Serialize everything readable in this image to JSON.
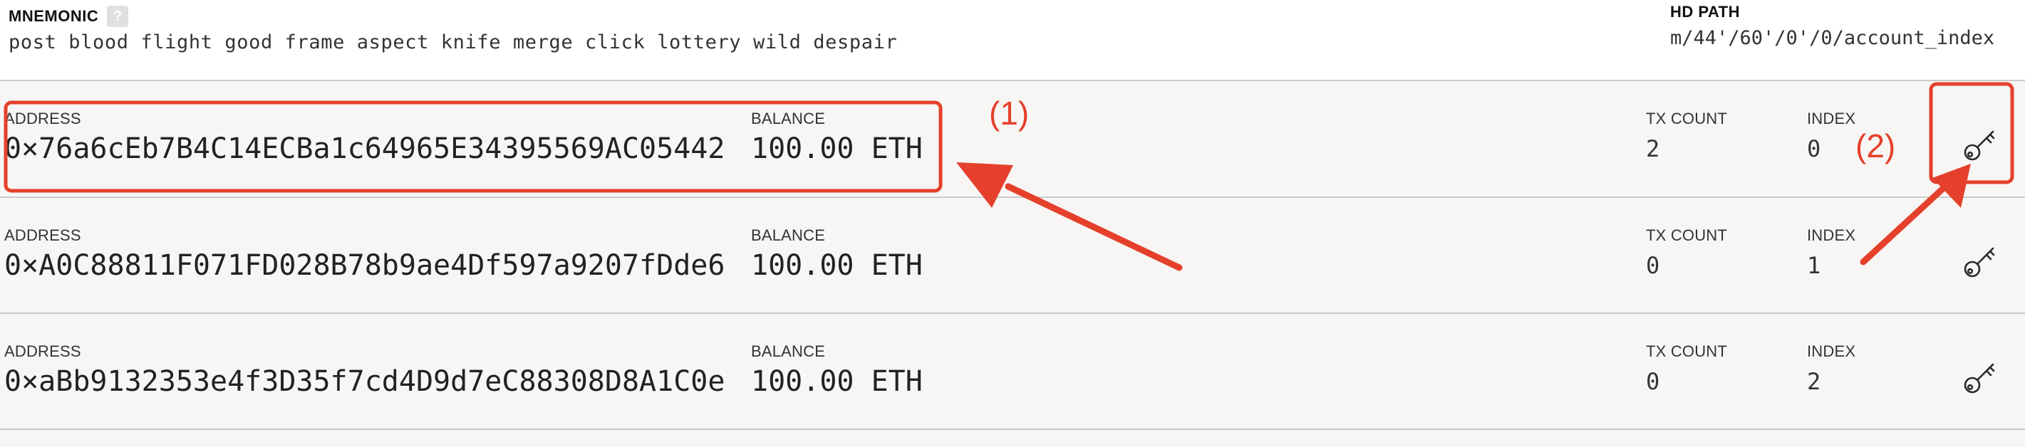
{
  "header": {
    "mnemonic_label": "MNEMONIC",
    "help_glyph": "?",
    "mnemonic_words": "post blood flight good frame aspect knife merge click lottery wild despair",
    "hd_path_label": "HD PATH",
    "hd_path_value": "m/44'/60'/0'/0/account_index"
  },
  "accounts": [
    {
      "address_label": "ADDRESS",
      "address": "0×76a6cEb7B4C14ECBa1c64965E34395569AC05442",
      "balance_label": "BALANCE",
      "balance": "100.00 ETH",
      "tx_count_label": "TX COUNT",
      "tx_count": "2",
      "index_label": "INDEX",
      "index": "0",
      "key_icon": "key-icon"
    },
    {
      "address_label": "ADDRESS",
      "address": "0×A0C88811F071FD028B78b9ae4Df597a9207fDde6",
      "balance_label": "BALANCE",
      "balance": "100.00 ETH",
      "tx_count_label": "TX COUNT",
      "tx_count": "0",
      "index_label": "INDEX",
      "index": "1",
      "key_icon": "key-icon"
    },
    {
      "address_label": "ADDRESS",
      "address": "0×aBb9132353e4f3D35f7cd4D9d7eC88308D8A1C0e",
      "balance_label": "BALANCE",
      "balance": "100.00 ETH",
      "tx_count_label": "TX COUNT",
      "tx_count": "0",
      "index_label": "INDEX",
      "index": "2",
      "key_icon": "key-icon"
    }
  ],
  "annotations": {
    "label_1": "(1)",
    "label_2": "(2)",
    "color": "#e5402b"
  },
  "colors": {
    "row_background": "#f7f6f4",
    "divider": "#c9c9c9",
    "annotation": "#e5402b"
  }
}
